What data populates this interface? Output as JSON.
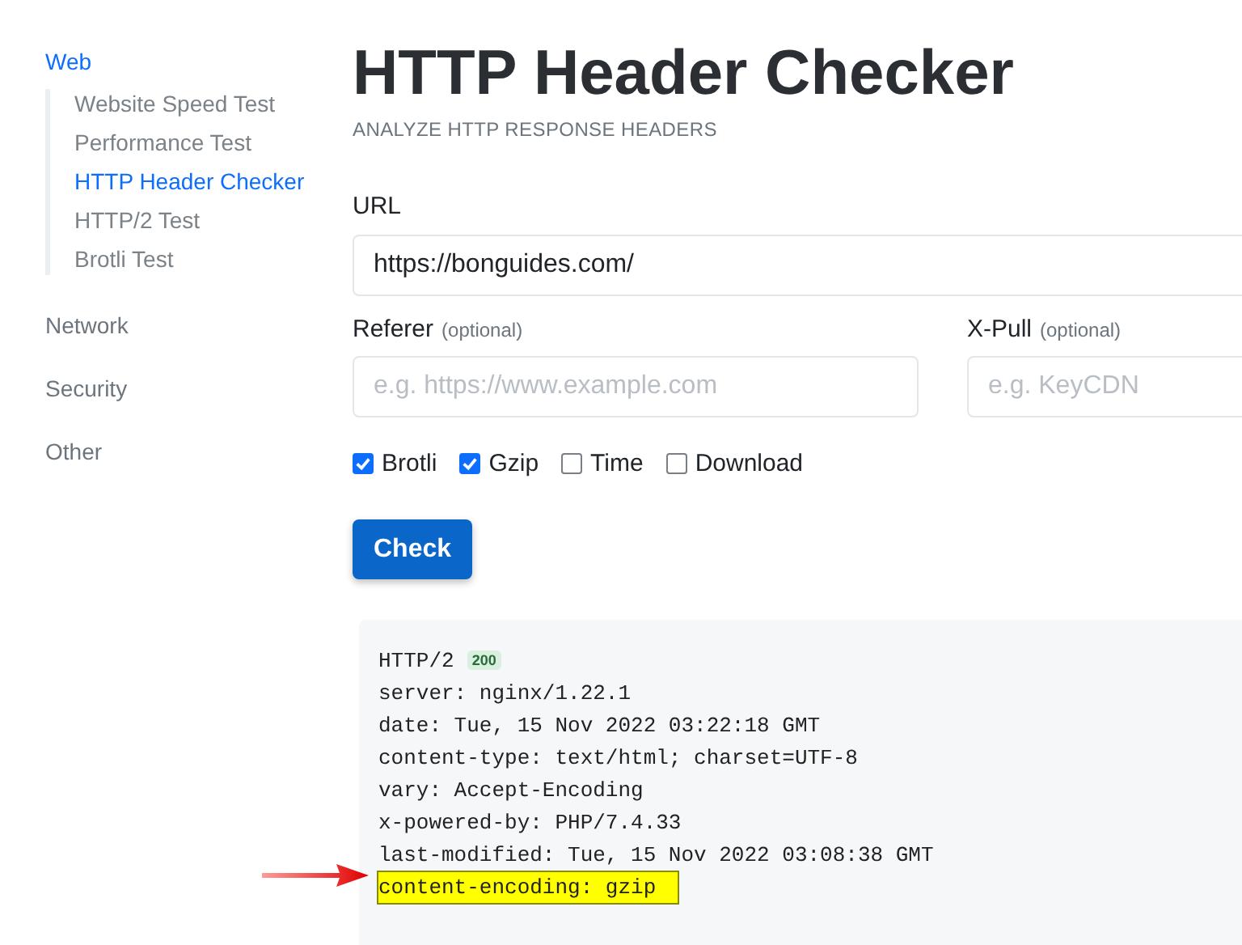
{
  "sidebar": {
    "groups": [
      {
        "label": "Web",
        "selected": true,
        "expanded": true,
        "children": [
          {
            "label": "Website Speed Test",
            "selected": false
          },
          {
            "label": "Performance Test",
            "selected": false
          },
          {
            "label": "HTTP Header Checker",
            "selected": true
          },
          {
            "label": "HTTP/2 Test",
            "selected": false
          },
          {
            "label": "Brotli Test",
            "selected": false
          }
        ]
      },
      {
        "label": "Network",
        "selected": false
      },
      {
        "label": "Security",
        "selected": false
      },
      {
        "label": "Other",
        "selected": false
      }
    ]
  },
  "page": {
    "title": "HTTP Header Checker",
    "subtitle": "ANALYZE HTTP RESPONSE HEADERS"
  },
  "form": {
    "url": {
      "label": "URL",
      "value": "https://bonguides.com/"
    },
    "referer": {
      "label": "Referer",
      "hint": "(optional)",
      "placeholder": "e.g. https://www.example.com"
    },
    "xpull": {
      "label": "X-Pull",
      "hint": "(optional)",
      "placeholder": "e.g. KeyCDN"
    },
    "options": [
      {
        "label": "Brotli",
        "checked": true
      },
      {
        "label": "Gzip",
        "checked": true
      },
      {
        "label": "Time",
        "checked": false
      },
      {
        "label": "Download",
        "checked": false
      }
    ],
    "submit": "Check"
  },
  "response": {
    "protocol": "HTTP/2",
    "status_code": "200",
    "headers": [
      {
        "text": "server: nginx/1.22.1",
        "highlighted": false
      },
      {
        "text": "date: Tue, 15 Nov 2022 03:22:18 GMT",
        "highlighted": false
      },
      {
        "text": "content-type: text/html; charset=UTF-8",
        "highlighted": false
      },
      {
        "text": "vary: Accept-Encoding",
        "highlighted": false
      },
      {
        "text": "x-powered-by: PHP/7.4.33",
        "highlighted": false
      },
      {
        "text": "last-modified: Tue, 15 Nov 2022 03:08:38 GMT",
        "highlighted": false
      },
      {
        "text": "content-encoding: gzip",
        "highlighted": true
      }
    ]
  }
}
